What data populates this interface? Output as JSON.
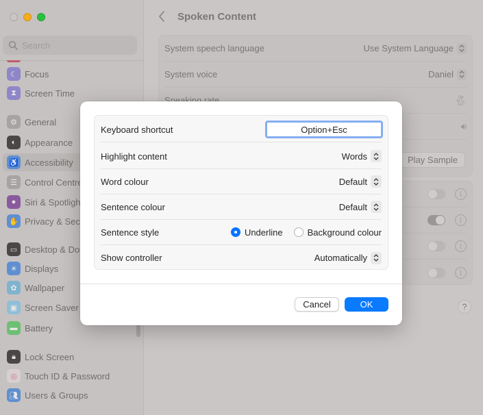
{
  "window": {
    "controls": [
      "close",
      "minimize",
      "maximize"
    ]
  },
  "sidebar": {
    "search_placeholder": "Search",
    "items": [
      {
        "label": "Focus",
        "icon": "moon-icon",
        "color": "#8e86c9"
      },
      {
        "label": "Screen Time",
        "icon": "hourglass-icon",
        "color": "#8e86c9"
      },
      {
        "label": "General",
        "icon": "gear-icon",
        "color": "#a7a3a2"
      },
      {
        "label": "Appearance",
        "icon": "appearance-icon",
        "color": "#4a4747"
      },
      {
        "label": "Accessibility",
        "icon": "accessibility-icon",
        "color": "#5f8fd0"
      },
      {
        "label": "Control Centre",
        "icon": "control-centre-icon",
        "color": "#a7a3a2"
      },
      {
        "label": "Siri & Spotlight",
        "icon": "siri-icon",
        "color": "#8a5a9e"
      },
      {
        "label": "Privacy & Security",
        "icon": "hand-icon",
        "color": "#5f8fd0"
      },
      {
        "label": "Desktop & Dock",
        "icon": "dock-icon",
        "color": "#4a4747"
      },
      {
        "label": "Displays",
        "icon": "sun-icon",
        "color": "#5f8fd0"
      },
      {
        "label": "Wallpaper",
        "icon": "flower-icon",
        "color": "#7fb3cf"
      },
      {
        "label": "Screen Saver",
        "icon": "screensaver-icon",
        "color": "#8fbfd7"
      },
      {
        "label": "Battery",
        "icon": "battery-icon",
        "color": "#6cbf73"
      },
      {
        "label": "Lock Screen",
        "icon": "lock-icon",
        "color": "#4a4747"
      },
      {
        "label": "Touch ID & Password",
        "icon": "fingerprint-icon",
        "color": "#d08b93"
      },
      {
        "label": "Users & Groups",
        "icon": "users-icon",
        "color": "#5f8fd0"
      }
    ],
    "active_item": "Accessibility"
  },
  "main": {
    "title": "Spoken Content",
    "rows": [
      {
        "label": "System speech language",
        "value": "Use System Language"
      },
      {
        "label": "System voice",
        "value": "Daniel"
      },
      {
        "label": "Speaking rate"
      }
    ],
    "play_sample": "Play Sample",
    "toggles": [
      false,
      true,
      false,
      false
    ],
    "help": "?"
  },
  "dialog": {
    "keyboard_shortcut": {
      "label": "Keyboard shortcut",
      "value": "Option+Esc"
    },
    "highlight_content": {
      "label": "Highlight content",
      "value": "Words"
    },
    "word_colour": {
      "label": "Word colour",
      "value": "Default"
    },
    "sentence_colour": {
      "label": "Sentence colour",
      "value": "Default"
    },
    "sentence_style": {
      "label": "Sentence style",
      "options": [
        "Underline",
        "Background colour"
      ],
      "selected": "Underline"
    },
    "show_controller": {
      "label": "Show controller",
      "value": "Automatically"
    },
    "cancel": "Cancel",
    "ok": "OK",
    "accent": "#0a7aff"
  }
}
